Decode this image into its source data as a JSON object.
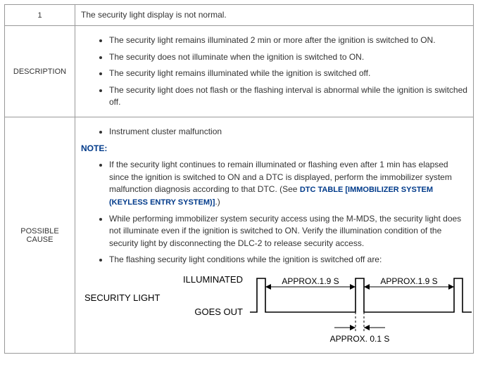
{
  "row1": {
    "num": "1",
    "text": "The security light display is not normal."
  },
  "description": {
    "label": "DESCRIPTION",
    "items": [
      "The security light remains illuminated 2 min or more after the ignition is switched to ON.",
      "The security does not illuminate when the ignition is switched to ON.",
      "The security light remains illuminated while the ignition is switched off.",
      "The security light does not flash or the flashing interval is abnormal while the ignition is switched off."
    ]
  },
  "possible_cause": {
    "label": "POSSIBLE CAUSE",
    "first_item": "Instrument cluster malfunction",
    "note_label": "NOTE:",
    "note_items": [
      {
        "pre": "If the security light continues to remain illuminated or flashing even after 1 min has elapsed since the ignition is switched to ON and a DTC is displayed, perform the immobilizer system malfunction diagnosis according to that DTC. (See ",
        "link": "DTC TABLE [IMMOBILIZER SYSTEM (KEYLESS ENTRY SYSTEM)]",
        "post": ".)"
      },
      {
        "pre": "While performing immobilizer system security access using the M-MDS, the security light does not illuminate even if the ignition is switched to ON. Verify the illumination condition of the security light by disconnecting the DLC-2 to release security access.",
        "link": "",
        "post": ""
      },
      {
        "pre": "The flashing security light conditions while the ignition is switched off are:",
        "link": "",
        "post": ""
      }
    ],
    "timing": {
      "security_light": "SECURITY LIGHT",
      "illuminated": "ILLUMINATED",
      "goes_out": "GOES OUT",
      "approx19": "APPROX.1.9 S",
      "approx01": "APPROX. 0.1 S"
    }
  },
  "chart_data": {
    "type": "line",
    "title": "Security light flashing pattern (ignition off)",
    "signal": "SECURITY LIGHT",
    "states": [
      "GOES OUT",
      "ILLUMINATED"
    ],
    "pattern_seconds": [
      {
        "state": "ILLUMINATED",
        "duration": 0.1
      },
      {
        "state": "GOES OUT",
        "duration": 1.9
      },
      {
        "state": "ILLUMINATED",
        "duration": 0.1
      },
      {
        "state": "GOES OUT",
        "duration": 1.9
      },
      {
        "state": "ILLUMINATED",
        "duration": 0.1
      }
    ],
    "annotations": {
      "high_duration_label": "APPROX. 0.1 S",
      "low_duration_label": "APPROX.1.9 S"
    }
  }
}
